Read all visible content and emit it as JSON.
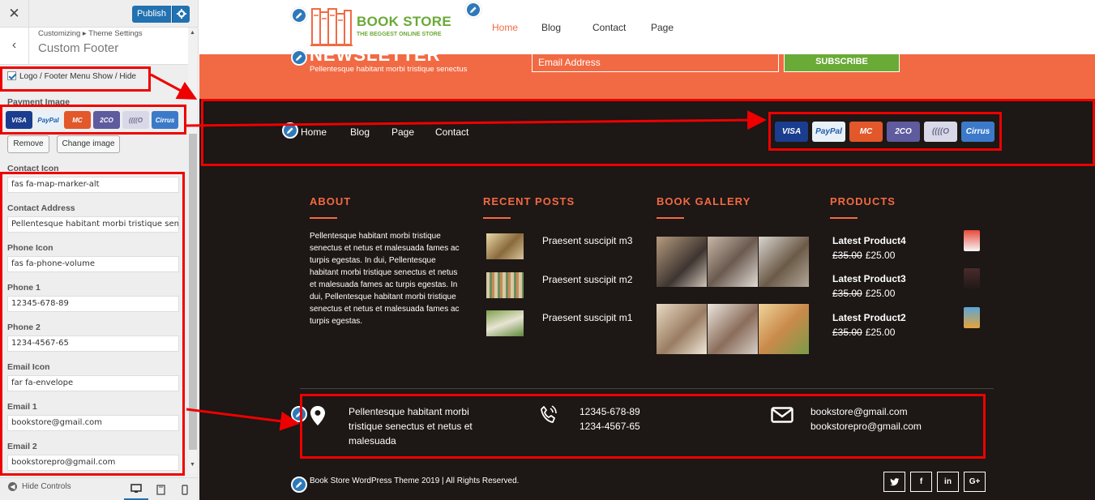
{
  "customizer": {
    "close_icon": "close-icon",
    "publish_label": "Publish",
    "breadcrumb": "Customizing ▸ Theme Settings",
    "section_title": "Custom Footer",
    "logo_menu_toggle_label": "Logo / Footer Menu Show / Hide",
    "logo_menu_toggle_checked": true,
    "payment_image_label": "Payment Image",
    "remove_label": "Remove",
    "change_image_label": "Change image",
    "fields": {
      "contact_icon": {
        "label": "Contact Icon",
        "value": "fas fa-map-marker-alt"
      },
      "contact_address": {
        "label": "Contact Address",
        "value": "Pellentesque habitant morbi tristique senectus"
      },
      "phone_icon": {
        "label": "Phone Icon",
        "value": "fas fa-phone-volume"
      },
      "phone_1": {
        "label": "Phone 1",
        "value": "12345-678-89"
      },
      "phone_2": {
        "label": "Phone 2",
        "value": "1234-4567-65"
      },
      "email_icon": {
        "label": "Email Icon",
        "value": "far fa-envelope"
      },
      "email_1": {
        "label": "Email 1",
        "value": "bookstore@gmail.com"
      },
      "email_2": {
        "label": "Email 2",
        "value": "bookstorepro@gmail.com"
      }
    },
    "hide_controls_label": "Hide Controls",
    "active_device": "desktop"
  },
  "payment_cards": [
    {
      "name": "VISA",
      "color": "#1a3d8f"
    },
    {
      "name": "PayPal",
      "color": "#e8f0f8"
    },
    {
      "name": "MasterCard",
      "color": "#e2582a"
    },
    {
      "name": "2CO",
      "color": "#5e5b9e"
    },
    {
      "name": "moneybookers",
      "color": "#d8d8e8"
    },
    {
      "name": "Cirrus",
      "color": "#3c7ac9"
    }
  ],
  "site": {
    "logo_title": "BOOK STORE",
    "logo_tagline": "THE BEGGEST ONLINE STORE",
    "menu": [
      "Home",
      "Blog",
      "Contact",
      "Page"
    ],
    "active_menu": "Home",
    "newsletter": {
      "title": "NEWSLETTER",
      "subtitle": "Pellentesque habitant morbi tristique senectus",
      "email_placeholder": "Email Address",
      "subscribe_label": "SUBSCRIBE"
    },
    "footer_menu": [
      "Home",
      "Blog",
      "Page",
      "Contact"
    ],
    "columns": {
      "about": {
        "title": "ABOUT",
        "text": "Pellentesque habitant morbi tristique senectus et netus et malesuada fames ac turpis egestas. In dui, Pellentesque habitant morbi tristique senectus et netus et malesuada fames ac turpis egestas. In dui, Pellentesque habitant morbi tristique senectus et netus et malesuada fames ac turpis egestas."
      },
      "recent_posts": {
        "title": "RECENT POSTS",
        "items": [
          "Praesent suscipit m3",
          "Praesent suscipit m2",
          "Praesent suscipit m1"
        ]
      },
      "gallery": {
        "title": "BOOK GALLERY"
      },
      "products": {
        "title": "PRODUCTS",
        "items": [
          {
            "name": "Latest Product4",
            "old_price": "£35.00",
            "price": "£25.00"
          },
          {
            "name": "Latest Product3",
            "old_price": "£35.00",
            "price": "£25.00"
          },
          {
            "name": "Latest Product2",
            "old_price": "£35.00",
            "price": "£25.00"
          }
        ]
      }
    },
    "contact": {
      "address": "Pellentesque habitant morbi tristique senectus et netus et malesuada",
      "phone_1": "12345-678-89",
      "phone_2": "1234-4567-65",
      "email_1": "bookstore@gmail.com",
      "email_2": "bookstorepro@gmail.com"
    },
    "copyright": "Book Store WordPress Theme 2019 | All Rights Reserved.",
    "social": [
      "twitter-icon",
      "facebook-icon",
      "linkedin-icon",
      "google-plus-icon"
    ],
    "accent_color": "#f26a43",
    "green_color": "#6aaa36"
  }
}
